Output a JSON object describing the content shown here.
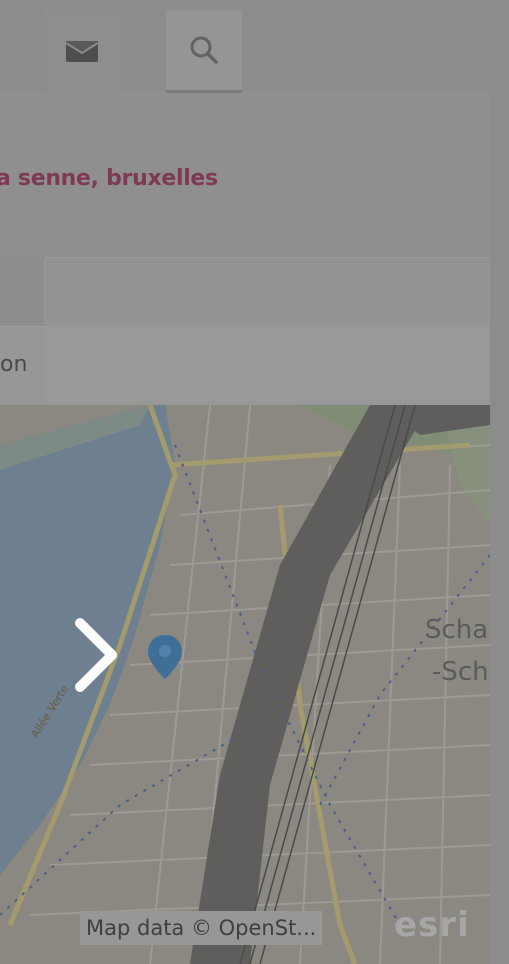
{
  "toolbar": {
    "mail_icon": "envelope-icon",
    "search_icon": "search-icon"
  },
  "location": {
    "title": "a senne, bruxelles",
    "color": "#7e3a55"
  },
  "form": {
    "field_1_value": "",
    "field_2_text": "on"
  },
  "map": {
    "labels": {
      "district_line_1": "Scha",
      "district_line_2": "-Sch",
      "street": "Allée Verte"
    },
    "attribution": "Map data © OpenSt...",
    "provider_logo": "esri",
    "marker_icon": "map-pin-icon",
    "nav_icon": "chevron-right-icon"
  },
  "colors": {
    "overlay_gray": "#8f8f8f",
    "marker_blue": "#3f6f97",
    "title_accent": "#7e3a55"
  }
}
